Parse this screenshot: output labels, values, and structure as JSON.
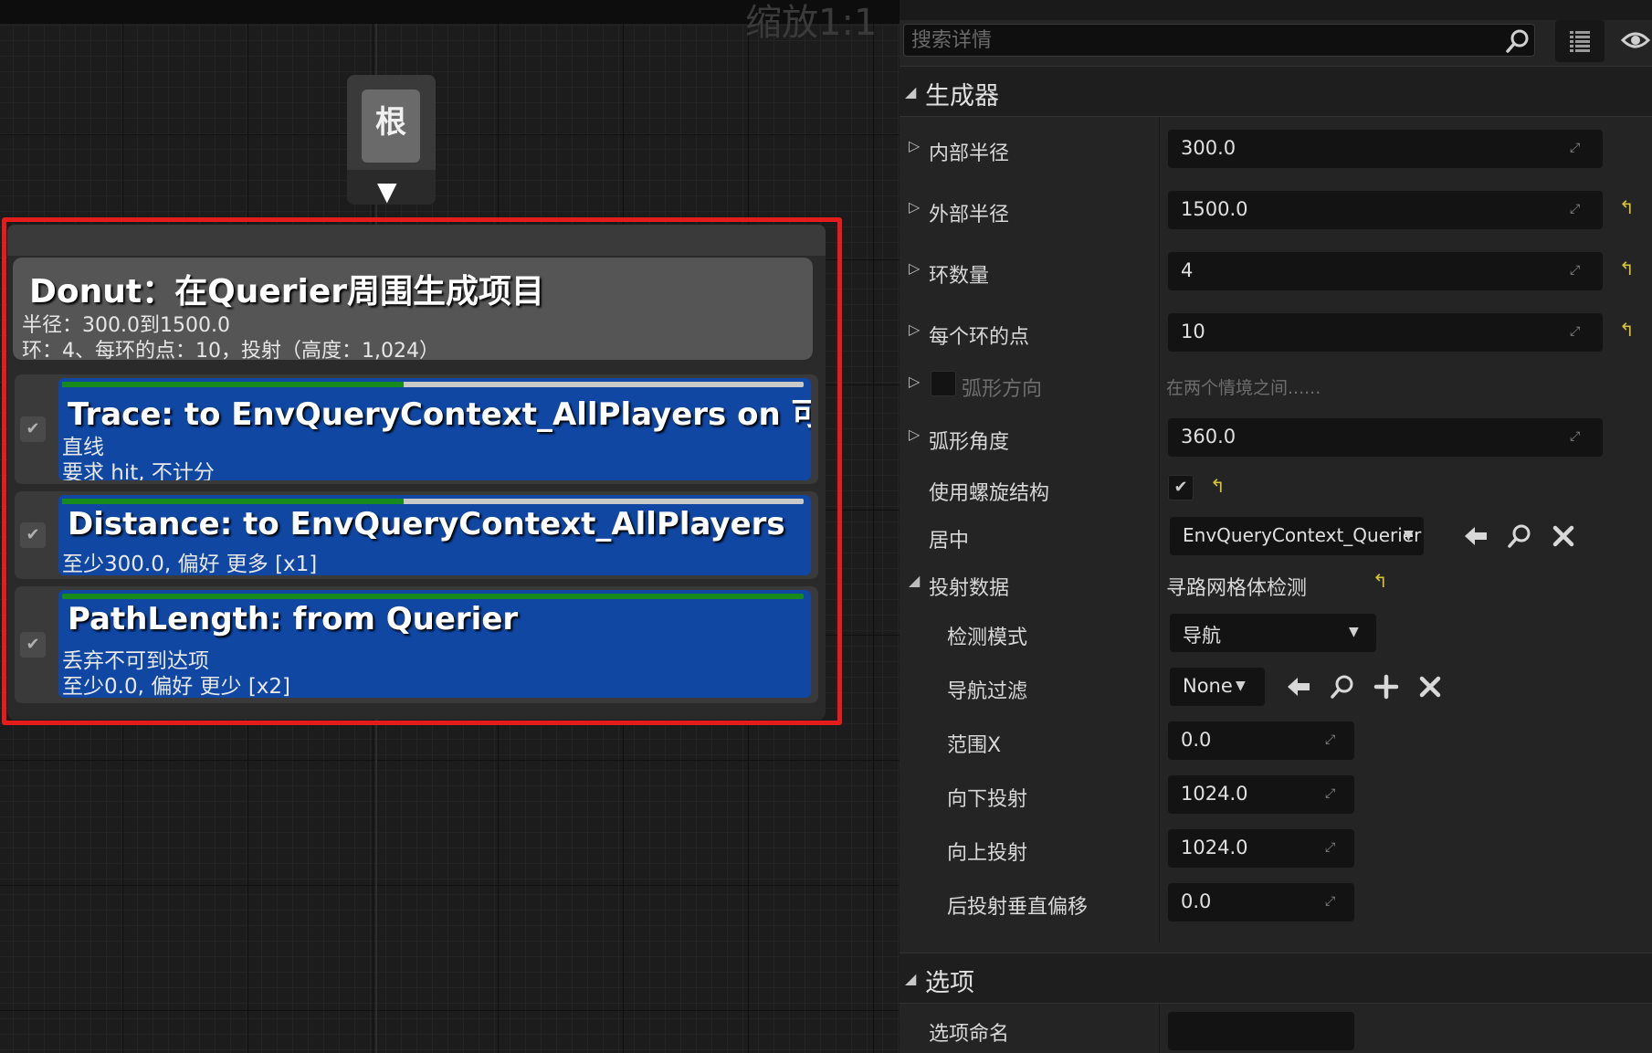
{
  "graph": {
    "zoom_label": "缩放1:1",
    "root_node": {
      "label": "根"
    },
    "generator_node": {
      "title": "Donut：在Querier周围生成项目",
      "subtitle_line1": "半径：300.0到1500.0",
      "subtitle_line2": "环：4、每环的点：10，投射（高度：1,024）",
      "tests": [
        {
          "title": "Trace: to EnvQueryContext_AllPlayers on 可视性",
          "lines": [
            "直线",
            "要求 hit, 不计分"
          ],
          "enabled": true,
          "score_fraction": 0.46
        },
        {
          "title": "Distance: to EnvQueryContext_AllPlayers",
          "lines": [
            "至少300.0, 偏好 更多 [x1]"
          ],
          "enabled": true,
          "score_fraction": 0.46
        },
        {
          "title": "PathLength: from Querier",
          "lines": [
            "丢弃不可到达项",
            "至少0.0, 偏好 更少 [x2]"
          ],
          "enabled": true,
          "score_fraction": 1.0
        }
      ]
    }
  },
  "details": {
    "search": {
      "placeholder": "搜索详情"
    },
    "categories": {
      "generator": "生成器",
      "options": "选项"
    },
    "props": {
      "inner_radius": {
        "label": "内部半径",
        "value": "300.0"
      },
      "outer_radius": {
        "label": "外部半径",
        "value": "1500.0"
      },
      "num_rings": {
        "label": "环数量",
        "value": "4"
      },
      "points_per_ring": {
        "label": "每个环的点",
        "value": "10"
      },
      "arc_direction": {
        "label": "弧形方向",
        "value": "在两个情境之间......"
      },
      "arc_angle": {
        "label": "弧形角度",
        "value": "360.0"
      },
      "use_spiral": {
        "label": "使用螺旋结构",
        "checked": true
      },
      "center": {
        "label": "居中",
        "value": "EnvQueryContext_Querier"
      },
      "projection": {
        "label": "投射数据",
        "value": "寻路网格体检测"
      },
      "trace_mode": {
        "label": "检测模式",
        "value": "导航"
      },
      "nav_filter": {
        "label": "导航过滤",
        "value": "None"
      },
      "extent_x": {
        "label": "范围X",
        "value": "0.0"
      },
      "project_down": {
        "label": "向下投射",
        "value": "1024.0"
      },
      "project_up": {
        "label": "向上投射",
        "value": "1024.0"
      },
      "post_offset": {
        "label": "后投射垂直偏移",
        "value": "0.0"
      },
      "option_name": {
        "label": "选项命名",
        "value": ""
      }
    }
  },
  "colors": {
    "highlight_border": "#e41c1c",
    "test_card": "#0f47a3",
    "score_bar": "#178b1b",
    "reset_arrow": "#d8c43a"
  }
}
